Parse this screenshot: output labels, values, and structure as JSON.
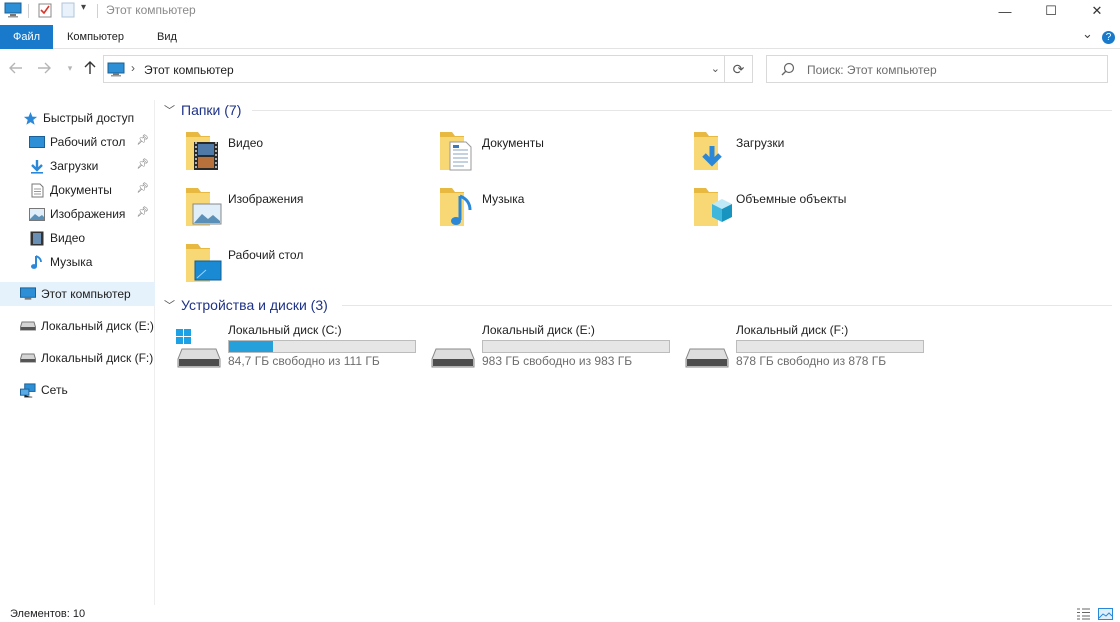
{
  "window": {
    "title": "Этот компьютер",
    "controls": {
      "minimize": "—",
      "maximize": "☐",
      "close": "✕"
    }
  },
  "ribbon": {
    "tabs": {
      "file": "Файл",
      "computer": "Компьютер",
      "view": "Вид"
    },
    "collapse_icon": "⌄",
    "help_icon": "?"
  },
  "address": {
    "path": "Этот компьютер",
    "separator": "›",
    "dropdown": "⌄",
    "refresh": "⟳"
  },
  "search": {
    "placeholder": "Поиск: Этот компьютер"
  },
  "sidebar": {
    "quick_access": "Быстрый доступ",
    "items": [
      {
        "label": "Рабочий стол",
        "icon": "desktop-icon",
        "pinned": true
      },
      {
        "label": "Загрузки",
        "icon": "downloads-icon",
        "pinned": true
      },
      {
        "label": "Документы",
        "icon": "documents-icon",
        "pinned": true
      },
      {
        "label": "Изображения",
        "icon": "pictures-icon",
        "pinned": true
      },
      {
        "label": "Видео",
        "icon": "video-icon",
        "pinned": false
      },
      {
        "label": "Музыка",
        "icon": "music-icon",
        "pinned": false
      }
    ],
    "this_pc": "Этот компьютер",
    "drive_e": "Локальный диск (E:)",
    "drive_f": "Локальный диск (F:)",
    "network": "Сеть"
  },
  "folders": {
    "header": "Папки (7)",
    "items": [
      {
        "label": "Видео",
        "icon": "video-folder-icon"
      },
      {
        "label": "Документы",
        "icon": "documents-folder-icon"
      },
      {
        "label": "Загрузки",
        "icon": "downloads-folder-icon"
      },
      {
        "label": "Изображения",
        "icon": "pictures-folder-icon"
      },
      {
        "label": "Музыка",
        "icon": "music-folder-icon"
      },
      {
        "label": "Объемные объекты",
        "icon": "3d-objects-folder-icon"
      },
      {
        "label": "Рабочий стол",
        "icon": "desktop-folder-icon"
      }
    ]
  },
  "drives": {
    "header": "Устройства и диски (3)",
    "items": [
      {
        "name": "Локальный диск (C:)",
        "free_text": "84,7 ГБ свободно из 111 ГБ",
        "used_fraction": 0.237
      },
      {
        "name": "Локальный диск (E:)",
        "free_text": "983 ГБ свободно из 983 ГБ",
        "used_fraction": 0
      },
      {
        "name": "Локальный диск (F:)",
        "free_text": "878 ГБ свободно из 878 ГБ",
        "used_fraction": 0
      }
    ]
  },
  "status": {
    "items_count": "Элементов: 10"
  },
  "colors": {
    "accent": "#1979ca",
    "folder": "#f8d775",
    "bar_fill": "#26a0da",
    "group_header": "#1e3287"
  }
}
